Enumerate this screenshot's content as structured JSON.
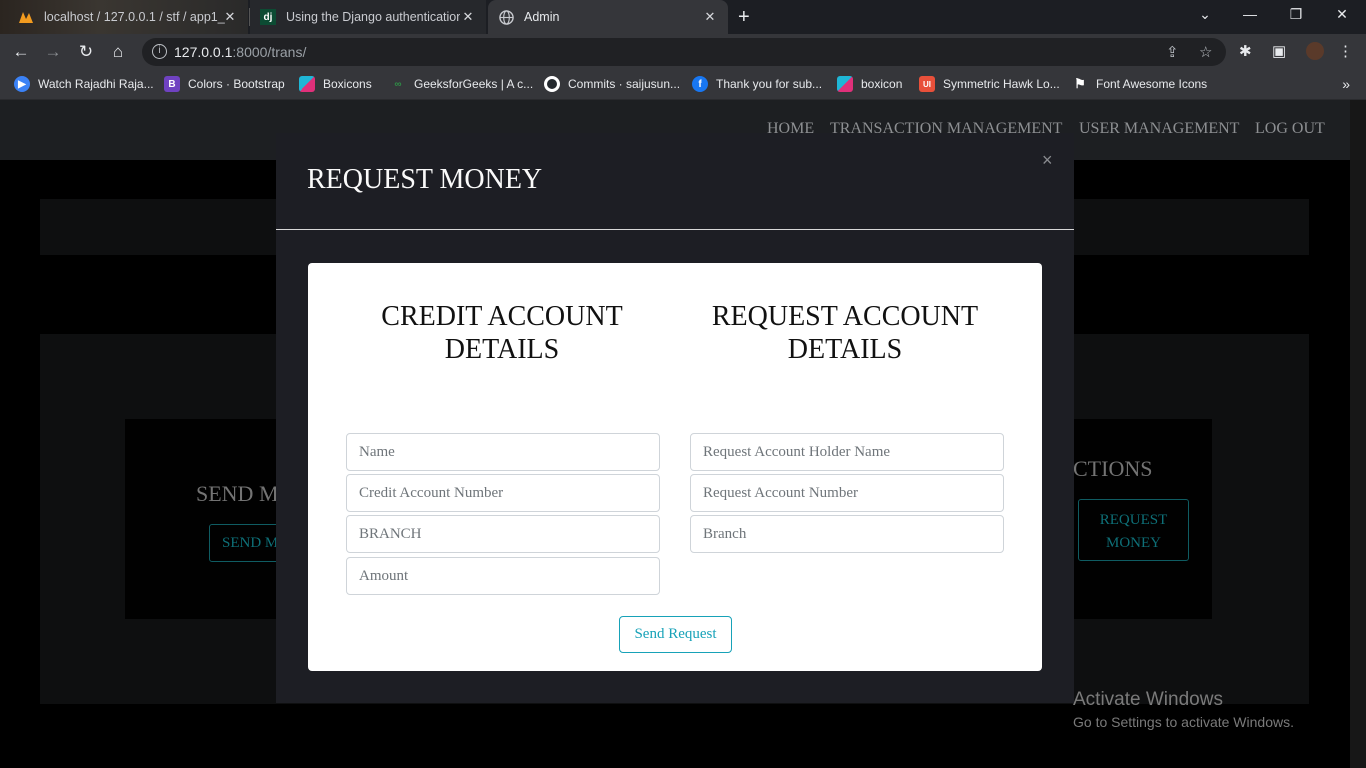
{
  "browser": {
    "tabs": [
      {
        "title": "localhost / 127.0.0.1 / stf / app1_",
        "icon": "phpmyadmin-icon"
      },
      {
        "title": "Using the Django authentication",
        "icon": "django-icon",
        "favicon_text": "dj"
      },
      {
        "title": "Admin",
        "icon": "globe-icon"
      }
    ],
    "url_host": "127.0.0.1",
    "url_rest": ":8000/trans/",
    "bookmarks": [
      {
        "label": "Watch Rajadhi Raja...",
        "color": "#3b82f6"
      },
      {
        "label": "Colors · Bootstrap",
        "color": "#6f42c1",
        "glyph": "B"
      },
      {
        "label": "Boxicons",
        "color": "#1fb6d6"
      },
      {
        "label": "GeeksforGeeks | A c...",
        "color": "#2f8d46",
        "glyph": "∞"
      },
      {
        "label": "Commits · saijusun...",
        "color": "#ffffff"
      },
      {
        "label": "Thank you for sub...",
        "color": "#1877f2",
        "glyph": "f"
      },
      {
        "label": "boxicon",
        "color": "#1fb6d6"
      },
      {
        "label": "Symmetric Hawk Lo...",
        "color": "#e8503a",
        "glyph": "UI"
      },
      {
        "label": "Font Awesome Icons",
        "color": "#ffffff",
        "glyph": "⚑"
      }
    ]
  },
  "site_nav": {
    "home": "HOME",
    "transaction": "TRANSACTION MANAGEMENT",
    "users": "USER MANAGEMENT",
    "logout": "LOG OUT"
  },
  "background": {
    "send_title": "SEND M",
    "send_button": "SEND M",
    "right_title": "CTIONS",
    "request_button_line1": "REQUEST",
    "request_button_line2": "MONEY"
  },
  "modal": {
    "title": "REQUEST MONEY",
    "close": "×",
    "credit_heading": "CREDIT ACCOUNT DETAILS",
    "request_heading": "REQUEST ACCOUNT DETAILS",
    "credit_fields": {
      "name": "Name",
      "account_number": "Credit Account Number",
      "branch": "BRANCH",
      "amount": "Amount"
    },
    "request_fields": {
      "holder_name": "Request Account Holder Name",
      "account_number": "Request Account Number",
      "branch": "Branch"
    },
    "submit": "Send Request"
  },
  "os_watermark": {
    "line1": "Activate Windows",
    "line2": "Go to Settings to activate Windows."
  },
  "colors": {
    "accent": "#17a2b8",
    "modal_bg": "#1d1e24",
    "page_bg": "#000000"
  }
}
